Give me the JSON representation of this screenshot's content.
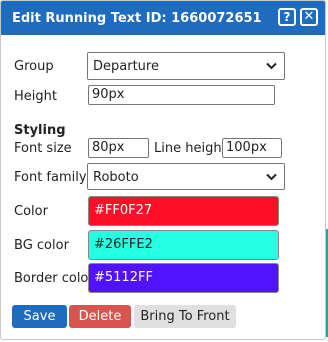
{
  "dialog": {
    "title": "Edit Running Text ID: 1660072651",
    "help_label": "?",
    "close_label": "✕"
  },
  "form": {
    "group_label": "Group",
    "group_value": "Departure",
    "height_label": "Height",
    "height_value": "90px",
    "styling_header": "Styling",
    "font_size_label": "Font size",
    "font_size_value": "80px",
    "line_height_label": "Line height",
    "line_height_value": "100px",
    "font_family_label": "Font family",
    "font_family_value": "Roboto",
    "color_label": "Color",
    "color_value": "#FF0F27",
    "bg_color_label": "BG color",
    "bg_color_value": "#26FFE2",
    "border_color_label": "Border color",
    "border_color_value": "#5112FF"
  },
  "buttons": {
    "save": "Save",
    "delete": "Delete",
    "bring_to_front": "Bring To Front"
  },
  "colors": {
    "titlebar": "#1e6bbf",
    "save_button": "#1e6bbf",
    "delete_button": "#d9534f",
    "front_button": "#e0e0e0"
  },
  "icons": [
    "help-icon",
    "close-icon",
    "chevron-down-icon"
  ]
}
